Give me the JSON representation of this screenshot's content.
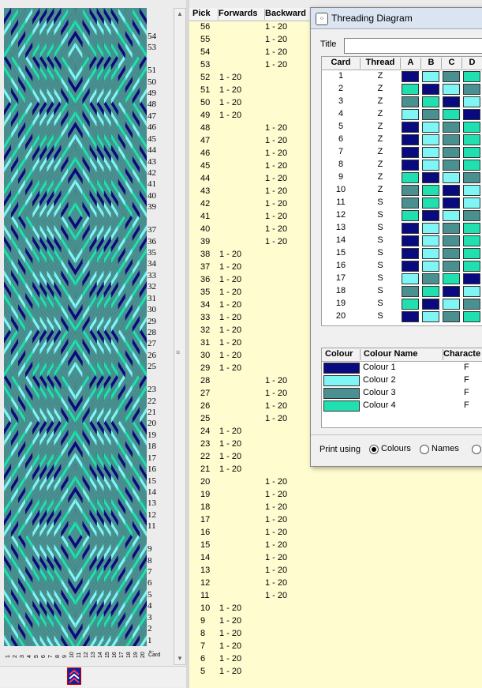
{
  "colors": {
    "c1": "#0a0a80",
    "c2": "#7ff5f5",
    "c3": "#4a9090",
    "c4": "#20e0b0"
  },
  "pattern_labels": [
    "54",
    "53",
    "51",
    "50",
    "49",
    "48",
    "47",
    "46",
    "45",
    "44",
    "43",
    "42",
    "41",
    "40",
    "39",
    "37",
    "36",
    "35",
    "34",
    "33",
    "32",
    "31",
    "30",
    "29",
    "28",
    "27",
    "26",
    "25",
    "23",
    "22",
    "21",
    "20",
    "19",
    "18",
    "17",
    "16",
    "15",
    "14",
    "13",
    "12",
    "11",
    "9",
    "8",
    "7",
    "6",
    "5",
    "4",
    "3",
    "2",
    "1"
  ],
  "card_axis": {
    "numbers": [
      "1",
      "2",
      "3",
      "4",
      "5",
      "6",
      "7",
      "8",
      "9",
      "10",
      "11",
      "12",
      "13",
      "14",
      "15",
      "16",
      "17",
      "18",
      "19",
      "20"
    ],
    "label": "Card"
  },
  "pick_table": {
    "headers": {
      "pick": "Pick",
      "forwards": "Forwards",
      "backwards": "Backward"
    },
    "rows": [
      {
        "pick": "56",
        "fwd": "",
        "bwd": "1 - 20"
      },
      {
        "pick": "55",
        "fwd": "",
        "bwd": "1 - 20"
      },
      {
        "pick": "54",
        "fwd": "",
        "bwd": "1 - 20"
      },
      {
        "pick": "53",
        "fwd": "",
        "bwd": "1 - 20"
      },
      {
        "pick": "52",
        "fwd": "1 - 20",
        "bwd": ""
      },
      {
        "pick": "51",
        "fwd": "1 - 20",
        "bwd": ""
      },
      {
        "pick": "50",
        "fwd": "1 - 20",
        "bwd": ""
      },
      {
        "pick": "49",
        "fwd": "1 - 20",
        "bwd": ""
      },
      {
        "pick": "48",
        "fwd": "",
        "bwd": "1 - 20"
      },
      {
        "pick": "47",
        "fwd": "",
        "bwd": "1 - 20"
      },
      {
        "pick": "46",
        "fwd": "",
        "bwd": "1 - 20"
      },
      {
        "pick": "45",
        "fwd": "",
        "bwd": "1 - 20"
      },
      {
        "pick": "44",
        "fwd": "",
        "bwd": "1 - 20"
      },
      {
        "pick": "43",
        "fwd": "",
        "bwd": "1 - 20"
      },
      {
        "pick": "42",
        "fwd": "",
        "bwd": "1 - 20"
      },
      {
        "pick": "41",
        "fwd": "",
        "bwd": "1 - 20"
      },
      {
        "pick": "40",
        "fwd": "",
        "bwd": "1 - 20"
      },
      {
        "pick": "39",
        "fwd": "",
        "bwd": "1 - 20"
      },
      {
        "pick": "38",
        "fwd": "1 - 20",
        "bwd": ""
      },
      {
        "pick": "37",
        "fwd": "1 - 20",
        "bwd": ""
      },
      {
        "pick": "36",
        "fwd": "1 - 20",
        "bwd": ""
      },
      {
        "pick": "35",
        "fwd": "1 - 20",
        "bwd": ""
      },
      {
        "pick": "34",
        "fwd": "1 - 20",
        "bwd": ""
      },
      {
        "pick": "33",
        "fwd": "1 - 20",
        "bwd": ""
      },
      {
        "pick": "32",
        "fwd": "1 - 20",
        "bwd": ""
      },
      {
        "pick": "31",
        "fwd": "1 - 20",
        "bwd": ""
      },
      {
        "pick": "30",
        "fwd": "1 - 20",
        "bwd": ""
      },
      {
        "pick": "29",
        "fwd": "1 - 20",
        "bwd": ""
      },
      {
        "pick": "28",
        "fwd": "",
        "bwd": "1 - 20"
      },
      {
        "pick": "27",
        "fwd": "",
        "bwd": "1 - 20"
      },
      {
        "pick": "26",
        "fwd": "",
        "bwd": "1 - 20"
      },
      {
        "pick": "25",
        "fwd": "",
        "bwd": "1 - 20"
      },
      {
        "pick": "24",
        "fwd": "1 - 20",
        "bwd": ""
      },
      {
        "pick": "23",
        "fwd": "1 - 20",
        "bwd": ""
      },
      {
        "pick": "22",
        "fwd": "1 - 20",
        "bwd": ""
      },
      {
        "pick": "21",
        "fwd": "1 - 20",
        "bwd": ""
      },
      {
        "pick": "20",
        "fwd": "",
        "bwd": "1 - 20"
      },
      {
        "pick": "19",
        "fwd": "",
        "bwd": "1 - 20"
      },
      {
        "pick": "18",
        "fwd": "",
        "bwd": "1 - 20"
      },
      {
        "pick": "17",
        "fwd": "",
        "bwd": "1 - 20"
      },
      {
        "pick": "16",
        "fwd": "",
        "bwd": "1 - 20"
      },
      {
        "pick": "15",
        "fwd": "",
        "bwd": "1 - 20"
      },
      {
        "pick": "14",
        "fwd": "",
        "bwd": "1 - 20"
      },
      {
        "pick": "13",
        "fwd": "",
        "bwd": "1 - 20"
      },
      {
        "pick": "12",
        "fwd": "",
        "bwd": "1 - 20"
      },
      {
        "pick": "11",
        "fwd": "",
        "bwd": "1 - 20"
      },
      {
        "pick": "10",
        "fwd": "1 - 20",
        "bwd": ""
      },
      {
        "pick": "9",
        "fwd": "1 - 20",
        "bwd": ""
      },
      {
        "pick": "8",
        "fwd": "1 - 20",
        "bwd": ""
      },
      {
        "pick": "7",
        "fwd": "1 - 20",
        "bwd": ""
      },
      {
        "pick": "6",
        "fwd": "1 - 20",
        "bwd": ""
      },
      {
        "pick": "5",
        "fwd": "1 - 20",
        "bwd": ""
      }
    ]
  },
  "dialog": {
    "title": "Threading Diagram",
    "title_label": "Title",
    "title_value": "",
    "grid_headers": {
      "card": "Card",
      "thread": "Thread",
      "a": "A",
      "b": "B",
      "c": "C",
      "d": "D"
    },
    "cards": [
      {
        "n": "1",
        "t": "Z",
        "a": "c1",
        "b": "c2",
        "c": "c3",
        "d": "c4"
      },
      {
        "n": "2",
        "t": "Z",
        "a": "c4",
        "b": "c1",
        "c": "c2",
        "d": "c3"
      },
      {
        "n": "3",
        "t": "Z",
        "a": "c3",
        "b": "c4",
        "c": "c1",
        "d": "c2"
      },
      {
        "n": "4",
        "t": "Z",
        "a": "c2",
        "b": "c3",
        "c": "c4",
        "d": "c1"
      },
      {
        "n": "5",
        "t": "Z",
        "a": "c1",
        "b": "c2",
        "c": "c3",
        "d": "c4"
      },
      {
        "n": "6",
        "t": "Z",
        "a": "c1",
        "b": "c2",
        "c": "c3",
        "d": "c4"
      },
      {
        "n": "7",
        "t": "Z",
        "a": "c1",
        "b": "c2",
        "c": "c3",
        "d": "c4"
      },
      {
        "n": "8",
        "t": "Z",
        "a": "c1",
        "b": "c2",
        "c": "c3",
        "d": "c4"
      },
      {
        "n": "9",
        "t": "Z",
        "a": "c4",
        "b": "c1",
        "c": "c2",
        "d": "c3"
      },
      {
        "n": "10",
        "t": "Z",
        "a": "c3",
        "b": "c4",
        "c": "c1",
        "d": "c2"
      },
      {
        "n": "11",
        "t": "S",
        "a": "c3",
        "b": "c4",
        "c": "c1",
        "d": "c2"
      },
      {
        "n": "12",
        "t": "S",
        "a": "c4",
        "b": "c1",
        "c": "c2",
        "d": "c3"
      },
      {
        "n": "13",
        "t": "S",
        "a": "c1",
        "b": "c2",
        "c": "c3",
        "d": "c4"
      },
      {
        "n": "14",
        "t": "S",
        "a": "c1",
        "b": "c2",
        "c": "c3",
        "d": "c4"
      },
      {
        "n": "15",
        "t": "S",
        "a": "c1",
        "b": "c2",
        "c": "c3",
        "d": "c4"
      },
      {
        "n": "16",
        "t": "S",
        "a": "c1",
        "b": "c2",
        "c": "c3",
        "d": "c4"
      },
      {
        "n": "17",
        "t": "S",
        "a": "c2",
        "b": "c3",
        "c": "c4",
        "d": "c1"
      },
      {
        "n": "18",
        "t": "S",
        "a": "c3",
        "b": "c4",
        "c": "c1",
        "d": "c2"
      },
      {
        "n": "19",
        "t": "S",
        "a": "c4",
        "b": "c1",
        "c": "c2",
        "d": "c3"
      },
      {
        "n": "20",
        "t": "S",
        "a": "c1",
        "b": "c2",
        "c": "c3",
        "d": "c4"
      }
    ],
    "colour_headers": {
      "colour": "Colour",
      "name": "Colour Name",
      "character": "Characte"
    },
    "colour_rows": [
      {
        "key": "c1",
        "name": "Colour 1",
        "ch": "F"
      },
      {
        "key": "c2",
        "name": "Colour 2",
        "ch": "F"
      },
      {
        "key": "c3",
        "name": "Colour 3",
        "ch": "F"
      },
      {
        "key": "c4",
        "name": "Colour 4",
        "ch": "F"
      }
    ],
    "print_using": {
      "label": "Print using",
      "options": [
        "Colours",
        "Names"
      ],
      "selected": "Colours"
    }
  }
}
